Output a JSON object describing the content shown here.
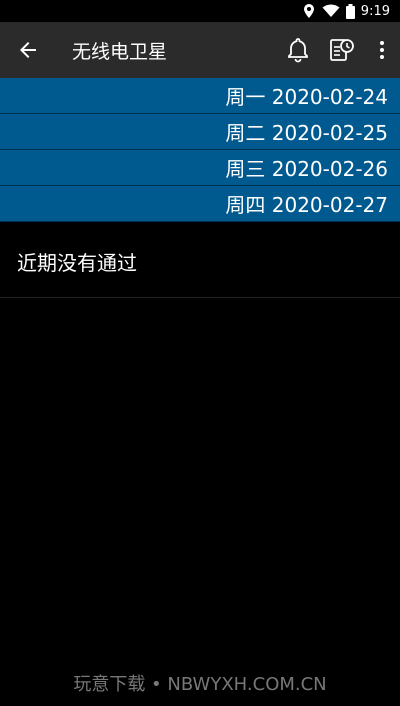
{
  "status": {
    "time": "9:19"
  },
  "app_bar": {
    "title": "无线电卫星"
  },
  "dates": [
    {
      "label": "周一 2020-02-24"
    },
    {
      "label": "周二 2020-02-25"
    },
    {
      "label": "周三 2020-02-26"
    },
    {
      "label": "周四 2020-02-27"
    }
  ],
  "message": "近期没有通过",
  "watermark": "玩意下载 • NBWYXH.COM.CN",
  "colors": {
    "app_bar": "#2b2b2b",
    "date_row": "#005a8f",
    "background": "#000000"
  }
}
